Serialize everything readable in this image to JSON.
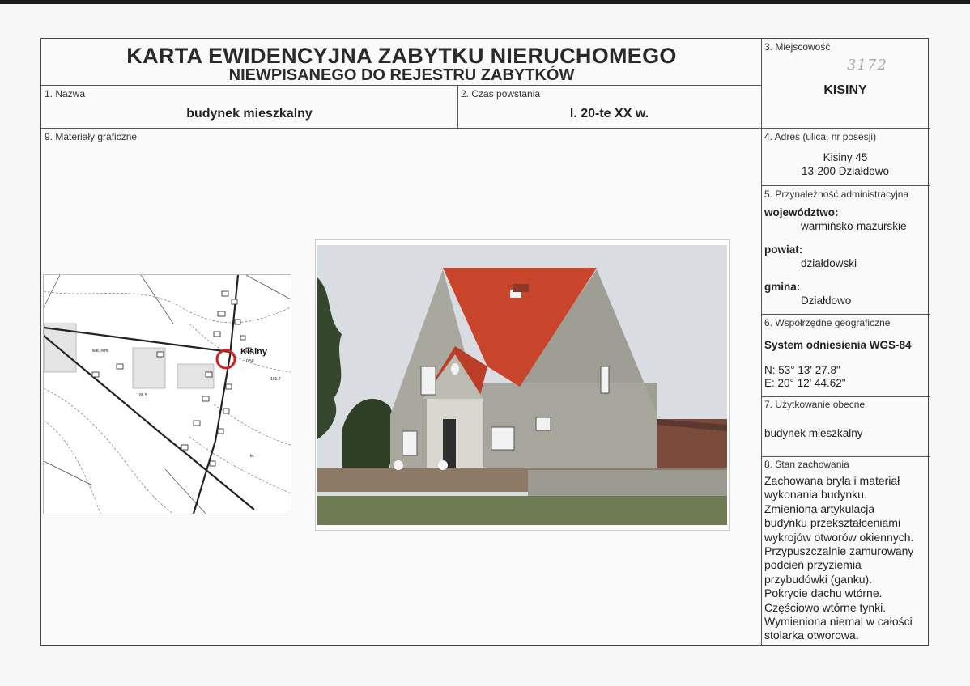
{
  "header": {
    "title_line1": "KARTA EWIDENCYJNA ZABYTKU NIERUCHOMEGO",
    "title_line2": "NIEWPISANEGO DO REJESTRU ZABYTKÓW"
  },
  "field_nazwa": {
    "label": "1. Nazwa",
    "value": "budynek mieszkalny"
  },
  "field_czas": {
    "label": "2. Czas powstania",
    "value": "l. 20-te XX w."
  },
  "field_miejscowosc": {
    "label": "3. Miejscowość",
    "handwritten_number": "3172",
    "value": "KISINY"
  },
  "field_adres": {
    "label": "4. Adres (ulica, nr posesji)",
    "line1": "Kisiny 45",
    "line2": "13-200 Działdowo"
  },
  "field_przynaleznosc": {
    "label": "5. Przynależność administracyjna",
    "wojewodztwo_label": "województwo:",
    "wojewodztwo": "warmińsko-mazurskie",
    "powiat_label": "powiat:",
    "powiat": "działdowski",
    "gmina_label": "gmina:",
    "gmina": "Działdowo"
  },
  "field_wspolrzedne": {
    "label": "6. Współrzędne geograficzne",
    "system": "System odniesienia WGS-84",
    "n": "N: 53° 13' 27.8\"",
    "e": "E: 20° 12' 44.62\""
  },
  "field_uzytkowanie": {
    "label": "7. Użytkowanie obecne",
    "value": "budynek mieszkalny"
  },
  "field_stan": {
    "label": "8. Stan zachowania",
    "lines": [
      "Zachowana bryła i materiał",
      "wykonania budynku.",
      "Zmieniona artykulacja",
      "budynku przekształceniami",
      "wykrojów otworów okiennych.",
      "Przypuszczalnie zamurowany",
      "podcień przyziemia",
      "przybudówki (ganku).",
      "Pokrycie dachu wtórne.",
      "Częściowo wtórne tynki.",
      "Wymieniona niemal w całości",
      "stolarka otworowa."
    ]
  },
  "field_materialy": {
    "label": "9. Materiały graficzne"
  },
  "map": {
    "place_label": "Kisiny",
    "elevation": "0.56",
    "label_101": "101.7",
    "label_108": "108.5",
    "label_kr": "kr.",
    "label_wat": "wat. rem."
  },
  "colors": {
    "roof": "#c8442b",
    "wall": "#a9a89f",
    "marker": "#d02020"
  }
}
